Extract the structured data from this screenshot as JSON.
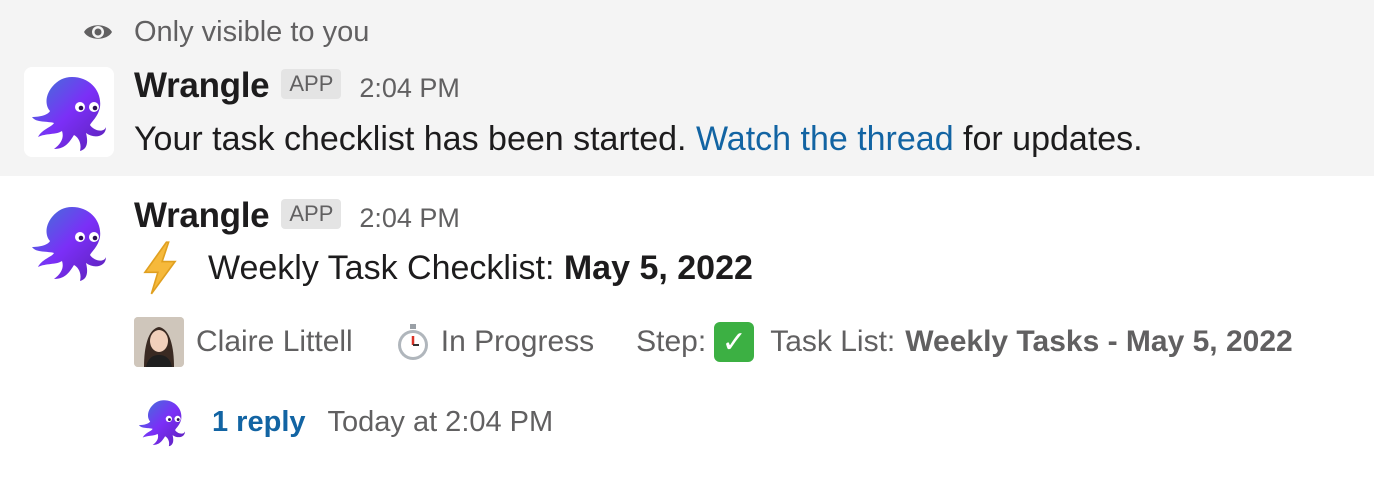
{
  "ephemeral_notice": {
    "icon": "eye-icon",
    "text": "Only visible to you"
  },
  "message1": {
    "sender": "Wrangle",
    "badge": "APP",
    "time": "2:04 PM",
    "text_before": "Your task checklist has been started. ",
    "link_text": "Watch the thread",
    "text_after": " for updates."
  },
  "message2": {
    "sender": "Wrangle",
    "badge": "APP",
    "time": "2:04 PM",
    "title_icon": "lightning-bolt-icon",
    "title_prefix": "Weekly Task Checklist: ",
    "title_bold": "May 5, 2022",
    "assignee": "Claire Littell",
    "status_icon": "stopwatch-icon",
    "status": "In Progress",
    "step_label": "Step:",
    "step_icon": "checkmark-icon",
    "tasklist_label": "Task List:",
    "tasklist_value": "Weekly Tasks - May 5, 2022"
  },
  "thread": {
    "reply_count": "1 reply",
    "last_reply": "Today at 2:04 PM"
  },
  "colors": {
    "link": "#1264a3",
    "brand_purple": "#6a2ed8",
    "check_green": "#3cb043",
    "ephemeral_bg": "#f4f4f4"
  }
}
